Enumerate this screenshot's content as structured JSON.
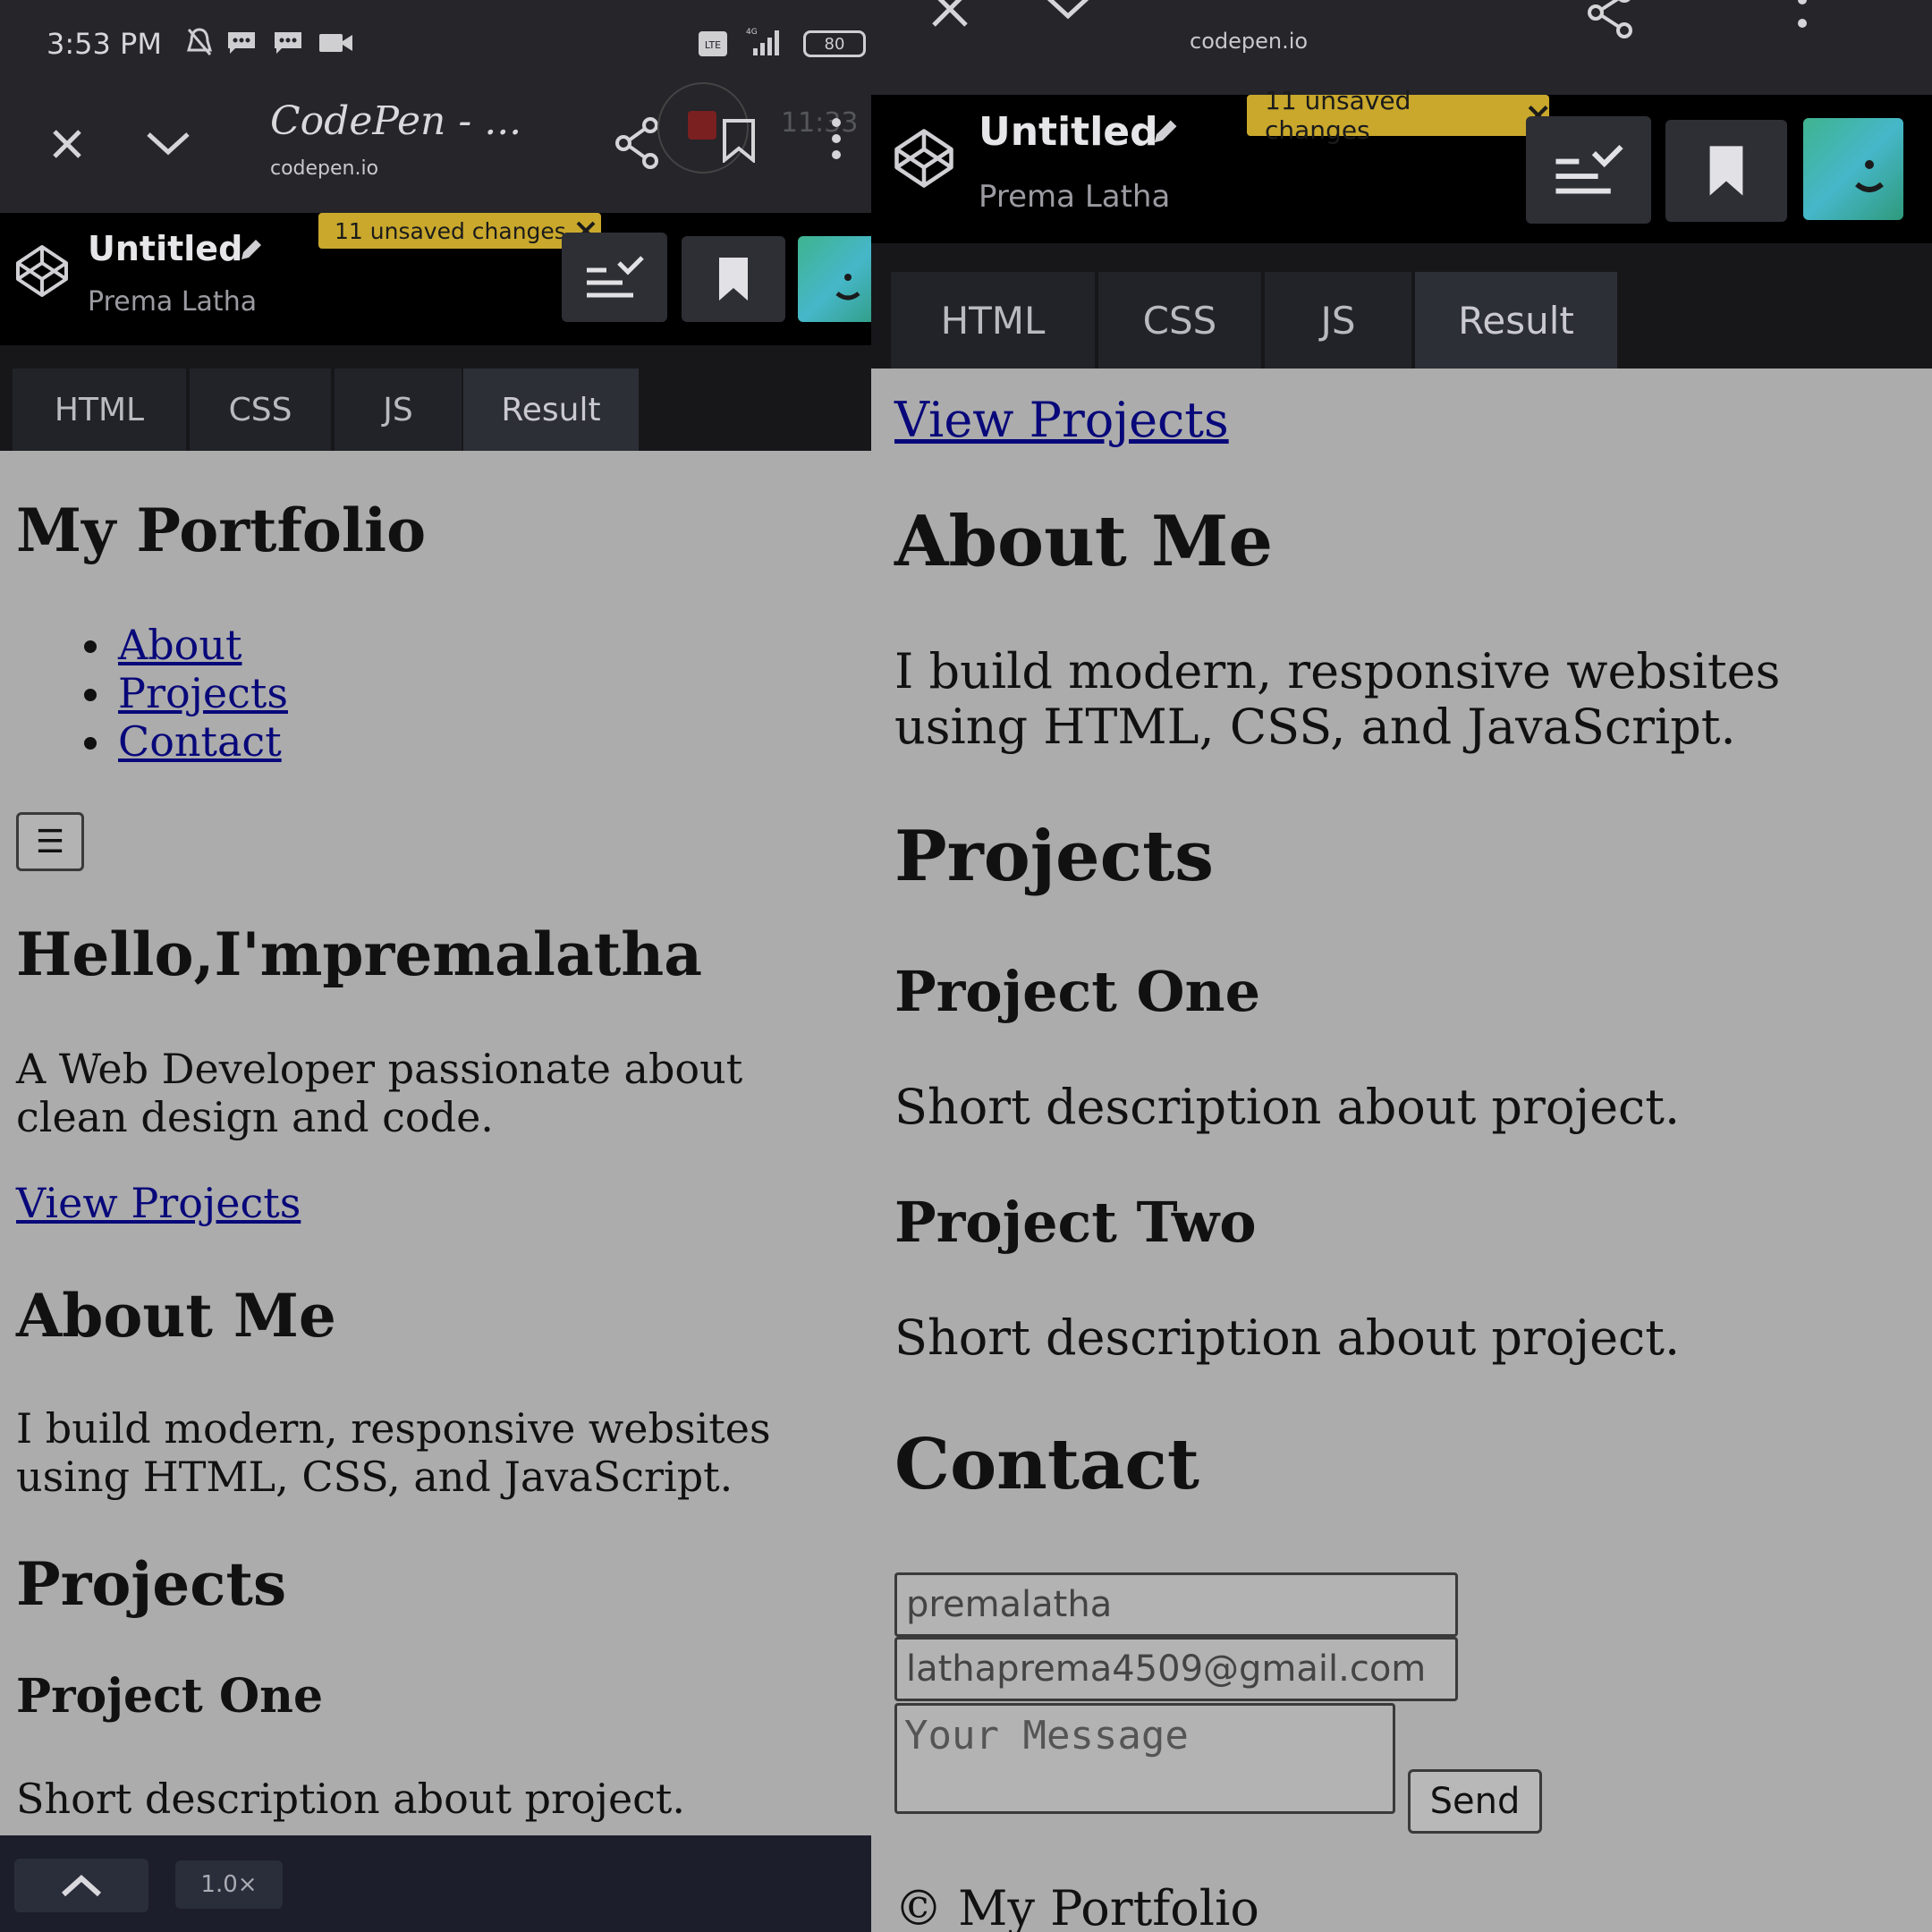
{
  "status": {
    "time": "3:53 PM",
    "battery": "80"
  },
  "browser": {
    "title": "CodePen - ...",
    "domain": "codepen.io",
    "overlay_time": "11:33"
  },
  "codepen": {
    "title": "Untitled",
    "author": "Prema Latha",
    "unsaved": "11 unsaved changes"
  },
  "tabs": [
    {
      "label": "HTML"
    },
    {
      "label": "CSS"
    },
    {
      "label": "JS"
    },
    {
      "label": "Result"
    }
  ],
  "page": {
    "heading": "My Portfolio",
    "nav": [
      "About",
      "Projects",
      "Contact"
    ],
    "menu_toggle": "☰",
    "hero_title": "Hello,I'mpremalatha",
    "hero_text": "A Web Developer passionate about clean design and code.",
    "view_projects": "View Projects",
    "about_heading": "About Me",
    "about_text": "I build modern, responsive websites using HTML, CSS, and JavaScript.",
    "projects_heading": "Projects",
    "projects": [
      {
        "title": "Project One",
        "desc": "Short description about project."
      },
      {
        "title": "Project Two",
        "desc": "Short description about project."
      }
    ],
    "contact_heading": "Contact",
    "form": {
      "name_value": "premalatha",
      "email_value": "lathaprema4509@gmail.com",
      "message_placeholder": "Your Message",
      "send_label": "Send"
    },
    "footer": "© My Portfolio"
  },
  "bottom": {
    "zoom": "1.0×"
  },
  "colors": {
    "unsaved_badge": "#c9a82c",
    "result_bg": "#acacac",
    "link": "#08087a"
  }
}
